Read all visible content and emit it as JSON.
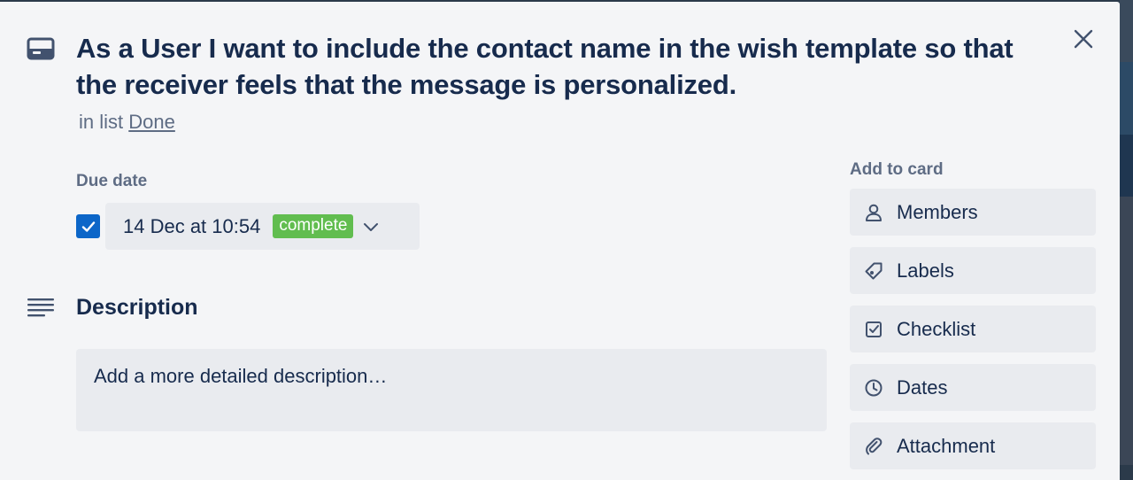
{
  "card": {
    "title": "As a User I want to include the contact name in the wish template so that the receiver feels that the message is personalized.",
    "in_list_prefix": "in list",
    "list_name": "Done"
  },
  "due_date": {
    "label": "Due date",
    "checked": true,
    "value": "14 Dec at 10:54",
    "status": "complete",
    "status_color": "#61bd4f"
  },
  "description": {
    "heading": "Description",
    "placeholder": "Add a more detailed description…"
  },
  "sidebar": {
    "heading": "Add to card",
    "items": [
      {
        "label": "Members",
        "icon": "person-icon"
      },
      {
        "label": "Labels",
        "icon": "tag-icon"
      },
      {
        "label": "Checklist",
        "icon": "checklist-icon"
      },
      {
        "label": "Dates",
        "icon": "clock-icon"
      },
      {
        "label": "Attachment",
        "icon": "paperclip-icon"
      }
    ]
  },
  "colors": {
    "accent": "#0c66c8",
    "text": "#172b4d",
    "muted": "#5e6c84",
    "modal_bg": "#f4f5f7",
    "button_bg": "#e9ebef"
  }
}
